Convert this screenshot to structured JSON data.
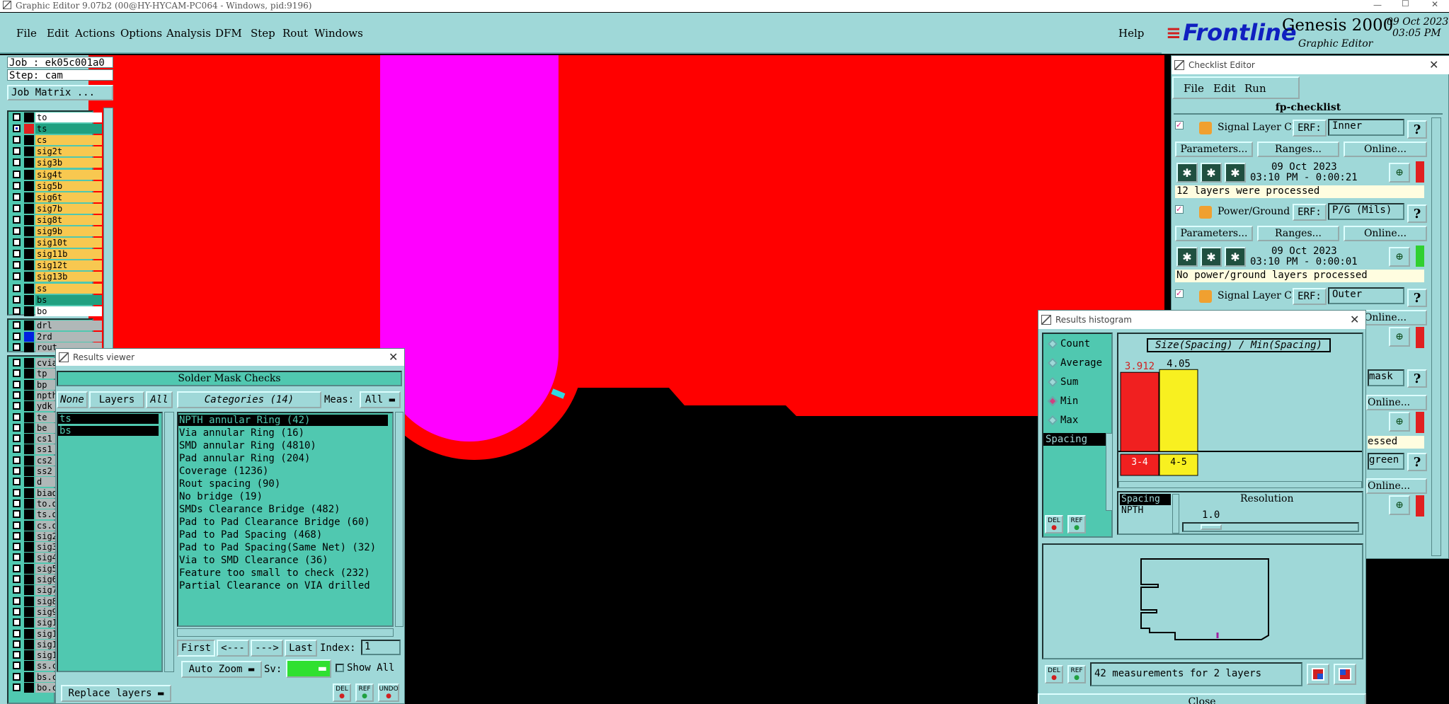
{
  "titlebar": {
    "text": "Graphic Editor 9.07b2 (00@HY-HYCAM-PC064 - Windows, pid:9196)"
  },
  "menu": {
    "file": "File",
    "edit": "Edit",
    "actions": "Actions",
    "options": "Options",
    "analysis": "Analysis",
    "dfm": "DFM",
    "step": "Step",
    "rout": "Rout",
    "windows": "Windows",
    "help": "Help"
  },
  "logo": {
    "brand": "Frontline",
    "product": "Genesis 2000",
    "sub": "Graphic Editor",
    "date": "09 Oct 2023",
    "time": "03:05 PM"
  },
  "job": {
    "job": "Job : ek05c001a0",
    "step": "Step: cam",
    "matrix": "Job Matrix ..."
  },
  "layers": [
    {
      "name": "to",
      "color": "#ffffff",
      "sel": false
    },
    {
      "name": "ts",
      "color": "#20a080",
      "sel": true
    },
    {
      "name": "cs",
      "color": "#f8c850",
      "sel": false
    },
    {
      "name": "sig2t",
      "color": "#f8c850",
      "sel": false
    },
    {
      "name": "sig3b",
      "color": "#f8c850",
      "sel": false
    },
    {
      "name": "sig4t",
      "color": "#f8c850",
      "sel": false
    },
    {
      "name": "sig5b",
      "color": "#f8c850",
      "sel": false
    },
    {
      "name": "sig6t",
      "color": "#f8c850",
      "sel": false
    },
    {
      "name": "sig7b",
      "color": "#f8c850",
      "sel": false
    },
    {
      "name": "sig8t",
      "color": "#f8c850",
      "sel": false
    },
    {
      "name": "sig9b",
      "color": "#f8c850",
      "sel": false
    },
    {
      "name": "sig10t",
      "color": "#f8c850",
      "sel": false
    },
    {
      "name": "sig11b",
      "color": "#f8c850",
      "sel": false
    },
    {
      "name": "sig12t",
      "color": "#f8c850",
      "sel": false
    },
    {
      "name": "sig13b",
      "color": "#f8c850",
      "sel": false
    },
    {
      "name": "ss",
      "color": "#f8c850",
      "sel": false
    },
    {
      "name": "bs",
      "color": "#20a080",
      "sel": false
    },
    {
      "name": "bo",
      "color": "#ffffff",
      "sel": false
    }
  ],
  "layers2": [
    {
      "name": "drl",
      "color": "#b0b8b8"
    },
    {
      "name": "2rd",
      "color": "#b0b8b8"
    },
    {
      "name": "rout",
      "color": "#b0b8b8"
    }
  ],
  "layers3": [
    "cvia",
    "tp",
    "bp",
    "npth",
    "ydk",
    "te",
    "be",
    "cs1",
    "ss1",
    "cs2",
    "ss2",
    "d",
    "biad",
    "to.d",
    "ts.d",
    "cs.d",
    "sig2",
    "sig3",
    "sig4",
    "sig5",
    "sig6",
    "sig7",
    "sig8",
    "sig9",
    "sig1",
    "sig1",
    "sig1",
    "sig1",
    "ss.c",
    "bs.c",
    "bo.c"
  ],
  "results_viewer": {
    "title": "Results viewer",
    "header": "Solder Mask Checks",
    "none": "None",
    "layers": "Layers",
    "all": "All",
    "categories": "Categories (14)",
    "meas": "Meas:",
    "meas_val": "All",
    "layer_items": [
      "ts",
      "bs"
    ],
    "category_items": [
      "NPTH annular Ring (42)",
      "Via annular Ring (16)",
      "SMD annular Ring (4810)",
      "Pad annular Ring (204)",
      "Coverage (1236)",
      "Rout spacing (90)",
      "No bridge (19)",
      "SMDs Clearance Bridge (482)",
      "Pad to Pad Clearance Bridge (60)",
      "Pad to Pad Spacing (468)",
      "Pad to Pad Spacing(Same Net) (32)",
      "Via to SMD Clearance (36)",
      "Feature too small to check (232)",
      "Partial Clearance on VIA drilled"
    ],
    "first": "First",
    "prev": "<---",
    "next": "--->",
    "last": "Last",
    "index": "Index:",
    "index_val": "1",
    "autozoom": "Auto Zoom",
    "sv": "Sv:",
    "showall": "Show All",
    "replace": "Replace layers",
    "del": "DEL",
    "ref": "REF",
    "undo": "UNDO"
  },
  "checklist": {
    "title": "Checklist Editor",
    "file": "File",
    "edit": "Edit",
    "run": "Run",
    "name": "fp-checklist",
    "blocks": [
      {
        "label": "Signal Layer Ch",
        "erf": "ERF:",
        "erf_val": "Inner",
        "params": "Parameters...",
        "ranges": "Ranges...",
        "online": "Online...",
        "date": "09 Oct 2023",
        "time": "03:10 PM - 0:00:21",
        "msg": "12 layers were processed",
        "status": "#e02020"
      },
      {
        "label": "Power/Ground C",
        "erf": "ERF:",
        "erf_val": "P/G (Mils)",
        "params": "Parameters...",
        "ranges": "Ranges...",
        "online": "Online...",
        "date": "09 Oct 2023",
        "time": "03:10 PM - 0:00:01",
        "msg": "No power/ground layers processed",
        "status": "#30d030"
      },
      {
        "label": "Signal Layer Ch",
        "erf": "ERF:",
        "erf_val": "Outer",
        "online": "Online..."
      }
    ],
    "tail": {
      "mask": "mask",
      "online1": "Online...",
      "essed": "essed",
      "green": "green",
      "online2": "Online..."
    }
  },
  "histogram": {
    "title": "Results histogram",
    "count": "Count",
    "average": "Average",
    "sum": "Sum",
    "min": "Min",
    "max": "Max",
    "spacing": "Spacing",
    "chart_title": "Size(Spacing) / Min(Spacing)",
    "bar1_label": "3.912",
    "bar2_label": "4.05",
    "bin1": "3-\n4",
    "bin2": "4-\n5",
    "bin1_color": "#f02020",
    "bin2_color": "#f8f020",
    "sel_spacing": "Spacing",
    "sel_npth": "NPTH",
    "resolution": "Resolution",
    "res_val": "1.0",
    "footer": "42 measurements for 2 layers",
    "close": "Close",
    "del": "DEL",
    "ref": "REF"
  },
  "chart_data": {
    "type": "bar",
    "title": "Size(Spacing) / Min(Spacing)",
    "categories": [
      "3-4",
      "4-5"
    ],
    "values": [
      3.912,
      4.05
    ],
    "colors": [
      "#f02020",
      "#f8f020"
    ]
  }
}
